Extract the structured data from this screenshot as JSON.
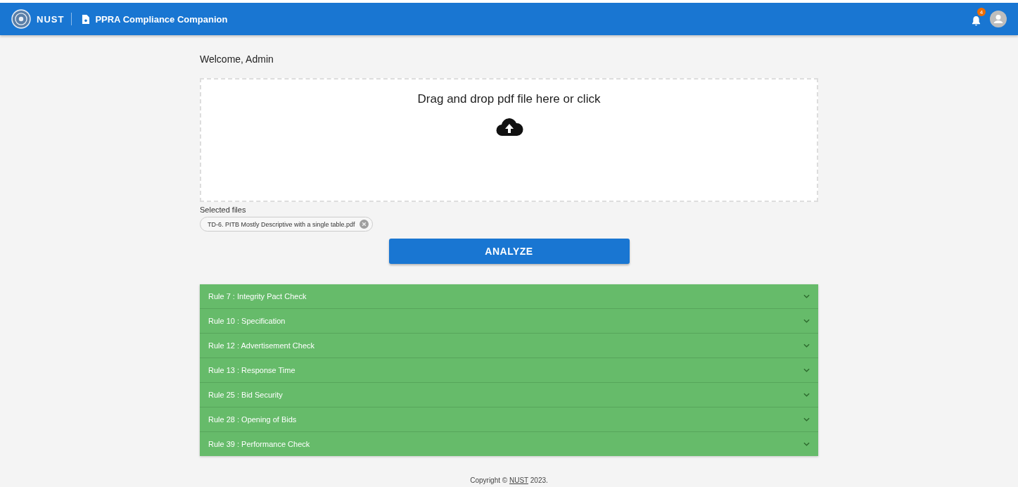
{
  "header": {
    "brand": "NUST",
    "app_title": "PPRA Compliance Companion",
    "notification_count": "4"
  },
  "welcome": "Welcome, Admin",
  "dropzone": {
    "prompt": "Drag and drop pdf file here or click"
  },
  "selected_files": {
    "label": "Selected files",
    "files": [
      "TD-6. PITB Mostly Descriptive with a single table.pdf"
    ]
  },
  "analyze_button": "ANALYZE",
  "rules": [
    {
      "label": "Rule 7 : Integrity Pact Check",
      "expanded": false
    },
    {
      "label": "Rule 10 : Specification",
      "expanded": false
    },
    {
      "label": "Rule 12 : Advertisement Check",
      "expanded": false
    },
    {
      "label": "Rule 13 : Response Time",
      "expanded": false
    },
    {
      "label": "Rule 25 : Bid Security",
      "expanded": false
    },
    {
      "label": "Rule 28 : Opening of Bids",
      "expanded": false
    },
    {
      "label": "Rule 39 : Performance Check",
      "expanded": false
    }
  ],
  "footer": {
    "before": "Copyright ©",
    "link": "NUST",
    "after": "2023."
  }
}
